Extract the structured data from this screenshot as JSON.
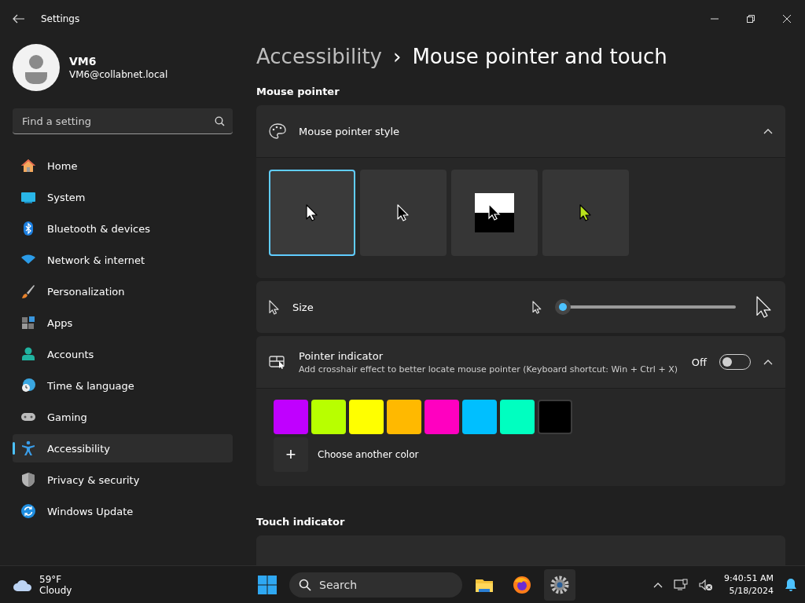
{
  "window": {
    "title": "Settings"
  },
  "user": {
    "name": "VM6",
    "email": "VM6@collabnet.local"
  },
  "search": {
    "placeholder": "Find a setting"
  },
  "sidebar": {
    "items": [
      {
        "label": "Home",
        "selected": false
      },
      {
        "label": "System",
        "selected": false
      },
      {
        "label": "Bluetooth & devices",
        "selected": false
      },
      {
        "label": "Network & internet",
        "selected": false
      },
      {
        "label": "Personalization",
        "selected": false
      },
      {
        "label": "Apps",
        "selected": false
      },
      {
        "label": "Accounts",
        "selected": false
      },
      {
        "label": "Time & language",
        "selected": false
      },
      {
        "label": "Gaming",
        "selected": false
      },
      {
        "label": "Accessibility",
        "selected": true
      },
      {
        "label": "Privacy & security",
        "selected": false
      },
      {
        "label": "Windows Update",
        "selected": false
      }
    ]
  },
  "breadcrumb": {
    "parent": "Accessibility",
    "separator": "›",
    "current": "Mouse pointer and touch"
  },
  "mouse_pointer": {
    "heading": "Mouse pointer",
    "style": {
      "label": "Mouse pointer style",
      "expanded": true,
      "options": [
        {
          "kind": "white",
          "selected": true
        },
        {
          "kind": "black",
          "selected": false
        },
        {
          "kind": "inverted",
          "selected": false
        },
        {
          "kind": "custom",
          "selected": false
        }
      ]
    },
    "size": {
      "label": "Size",
      "level": 0.0
    },
    "indicator": {
      "label": "Pointer indicator",
      "description": "Add crosshair effect to better locate mouse pointer (Keyboard shortcut: Win + Ctrl + X)",
      "state_text": "Off",
      "on": false,
      "expanded": true,
      "colors": [
        {
          "color": "#c000ff"
        },
        {
          "color": "#b8ff00"
        },
        {
          "color": "#ffff00"
        },
        {
          "color": "#ffb900"
        },
        {
          "color": "#ff00c0"
        },
        {
          "color": "#00bfff"
        },
        {
          "color": "#00ffc0"
        },
        {
          "color": "#000000"
        }
      ],
      "add_label": "Choose another color",
      "add_symbol": "+"
    }
  },
  "touch_indicator": {
    "heading": "Touch indicator"
  },
  "taskbar": {
    "weather": {
      "temp": "59°F",
      "condition": "Cloudy"
    },
    "search_label": "Search",
    "time": "9:40:51 AM",
    "date": "5/18/2024"
  }
}
